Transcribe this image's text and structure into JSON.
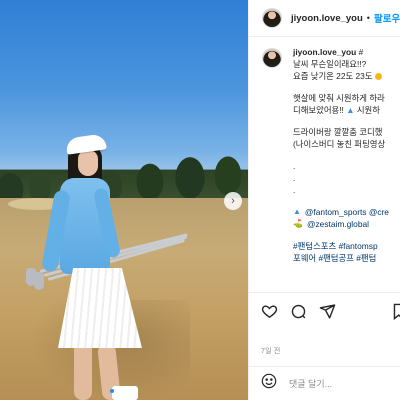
{
  "post": {
    "username": "jiyoon.love_you",
    "separator": "•",
    "follow_label": "팔로우",
    "caption_username": "jiyoon.love_you",
    "caption_lines": [
      "#",
      "날씨 무슨일이래요!!?",
      "요즘 낮기온 22도 23도",
      "",
      "햇살에 맞춰 시원하게 하라",
      "디해보았어용!!",
      "",
      "드라이버랑 깔깔춤 코디했",
      "(나이스버디 놓친 퍼팅영상",
      "",
      ".",
      ".",
      "."
    ],
    "inline_text_after_drop": "시원하",
    "mentions": [
      {
        "icon": "dress-icon",
        "text": "@fantom_sports @cre"
      },
      {
        "icon": "golfer-icon",
        "text": "@zestaim.global"
      }
    ],
    "hashtag_lines": [
      "#팬텀스포츠 #fantomsp",
      "포웨어 #팬텀공프 #팬텀"
    ],
    "time_ago": "7일 전",
    "comment_placeholder": "댓글 달기..."
  },
  "carousel": {
    "next_label": "›",
    "slide_count": 4,
    "active_slide": 1
  },
  "icons": {
    "like": "heart-icon",
    "comment": "comment-icon",
    "share": "share-icon",
    "save": "bookmark-icon",
    "emoji": "emoji-icon"
  },
  "colors": {
    "accent": "#0095f6",
    "hashtag": "#00376b",
    "active_dot": "#1e8ff0"
  }
}
